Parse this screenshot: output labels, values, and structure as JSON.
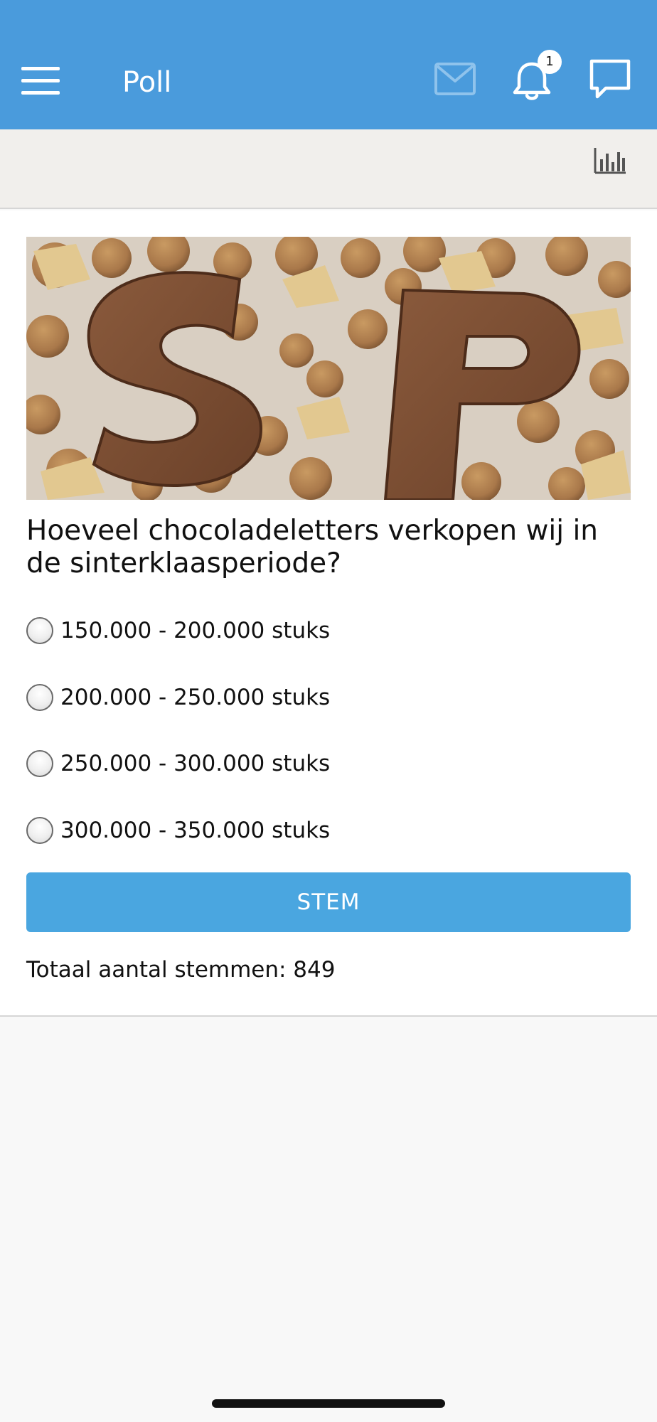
{
  "header": {
    "title": "Poll",
    "menu_icon": "hamburger-menu-icon",
    "mail_icon": "mail-icon",
    "notifications_icon": "bell-icon",
    "notification_count": "1",
    "chat_icon": "chat-icon",
    "background_color": "#4a9bdc"
  },
  "toolbar": {
    "results_icon": "bar-chart-icon"
  },
  "poll": {
    "image_subject": "chocolate-letters-s-p-with-pepernoten",
    "question": "Hoeveel chocoladeletters verkopen wij in de sinterklaasperiode?",
    "options": [
      {
        "label": "150.000 - 200.000 stuks",
        "selected": false
      },
      {
        "label": "200.000 - 250.000 stuks",
        "selected": false
      },
      {
        "label": "250.000 - 300.000 stuks",
        "selected": false
      },
      {
        "label": "300.000 - 350.000 stuks",
        "selected": false
      }
    ],
    "vote_button_label": "STEM",
    "vote_button_color": "#4aa6e0",
    "total_votes_text": "Totaal aantal stemmen: 849"
  }
}
